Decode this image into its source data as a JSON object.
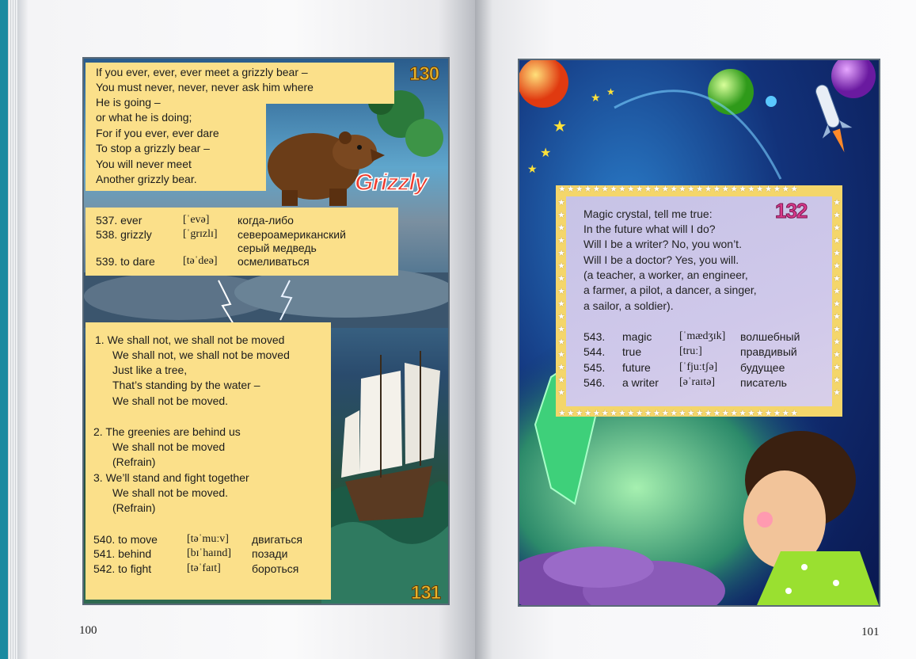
{
  "left_page": {
    "page_number": "100",
    "poem_130": {
      "number": "130",
      "lines": [
        "If you ever, ever, ever meet a grizzly bear –",
        "You must never, never, never ask him where",
        "He is going –",
        "or what he is doing;",
        "For if you ever, ever dare",
        "To stop a grizzly bear –",
        "You will never meet",
        "Another grizzly bear."
      ],
      "illustration_label": "Grizzly",
      "vocab": [
        {
          "num": "537. ever",
          "ipa": "[ˈevə]",
          "ru": "когда-либо"
        },
        {
          "num": "538. grizzly",
          "ipa": "[ˈgrɪzlɪ]",
          "ru": "североамериканский"
        },
        {
          "num": "",
          "ipa": "",
          "ru": "серый медведь"
        },
        {
          "num": "539. to dare",
          "ipa": "[təˈdeə]",
          "ru": "осмеливаться"
        }
      ]
    },
    "song_131": {
      "number": "131",
      "lines": [
        "1.  We shall not, we shall not be moved",
        "We shall not, we shall not be moved",
        "Just like a tree,",
        "That’s standing by the water –",
        "We shall not be moved.",
        "2.  The greenies are behind us",
        "We shall not be moved",
        "(Refrain)",
        "3.  We’ll stand and fight together",
        "We shall not be moved.",
        "(Refrain)"
      ],
      "vocab": [
        {
          "num": "540. to move",
          "ipa": "[təˈmuːv]",
          "ru": "двигаться"
        },
        {
          "num": "541. behind",
          "ipa": "[bɪˈhaɪnd]",
          "ru": "позади"
        },
        {
          "num": "542. to fight",
          "ipa": "[təˈfaɪt]",
          "ru": "бороться"
        }
      ]
    }
  },
  "right_page": {
    "page_number": "101",
    "poem_132": {
      "number": "132",
      "lines": [
        "Magic crystal, tell me true:",
        "In the future what will I do?",
        "Will I be a writer? No, you won’t.",
        "Will I be a doctor? Yes, you will.",
        "(a teacher, a worker, an engineer,",
        "a farmer, a pilot, a dancer, a singer,",
        "a sailor, a soldier)."
      ],
      "vocab": [
        {
          "num": "543.",
          "word": "magic",
          "ipa": "[ˈmædʒɪk]",
          "ru": "волшебный"
        },
        {
          "num": "544.",
          "word": "true",
          "ipa": "[truː]",
          "ru": "правдивый"
        },
        {
          "num": "545.",
          "word": "future",
          "ipa": "[ˈfjuːtʃə]",
          "ru": "будущее"
        },
        {
          "num": "546.",
          "word": "a writer",
          "ipa": "[əˈraɪtə]",
          "ru": "писатель"
        }
      ]
    }
  }
}
